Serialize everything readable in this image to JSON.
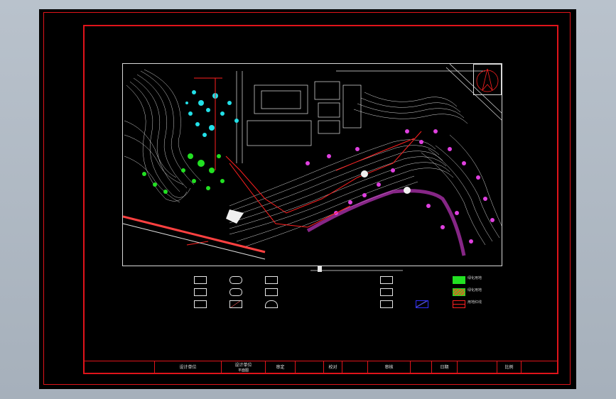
{
  "colors": {
    "background": "#000000",
    "frame": "#e0141a",
    "contour": "#d8d8d8",
    "cyan": "#22e0e8",
    "green": "#22e022",
    "magenta": "#e040e0",
    "red": "#ff2020",
    "blue": "#3030ff"
  },
  "title_block": {
    "cells": [
      "设计单位",
      "设计单位",
      "审定",
      "校对",
      "审核",
      "日期",
      "比例"
    ],
    "sub_label": "平面图"
  },
  "legend": {
    "items": [
      {
        "icon": "box-symbol-icon",
        "label": ""
      },
      {
        "icon": "round-symbol-icon",
        "label": ""
      },
      {
        "icon": "box-symbol-icon",
        "label": ""
      },
      {
        "icon": "box-symbol-icon",
        "label": ""
      },
      {
        "icon": "green-fill-icon",
        "label": "绿化用地"
      },
      {
        "icon": "box-symbol-icon",
        "label": ""
      },
      {
        "icon": "round-symbol-icon",
        "label": ""
      },
      {
        "icon": "box-symbol-icon",
        "label": ""
      },
      {
        "icon": "box-symbol-icon",
        "label": ""
      },
      {
        "icon": "hatch-fill-icon",
        "label": "绿化用地"
      },
      {
        "icon": "box-symbol-icon",
        "label": ""
      },
      {
        "icon": "line-symbol-icon",
        "label": ""
      },
      {
        "icon": "arc-symbol-icon",
        "label": ""
      },
      {
        "icon": "box-symbol-icon",
        "label": ""
      },
      {
        "icon": "blue-line-icon",
        "label": ""
      },
      {
        "icon": "red-line-icon",
        "label": "用地红线"
      }
    ]
  },
  "map": {
    "north_arrow": "north-arrow-icon"
  }
}
